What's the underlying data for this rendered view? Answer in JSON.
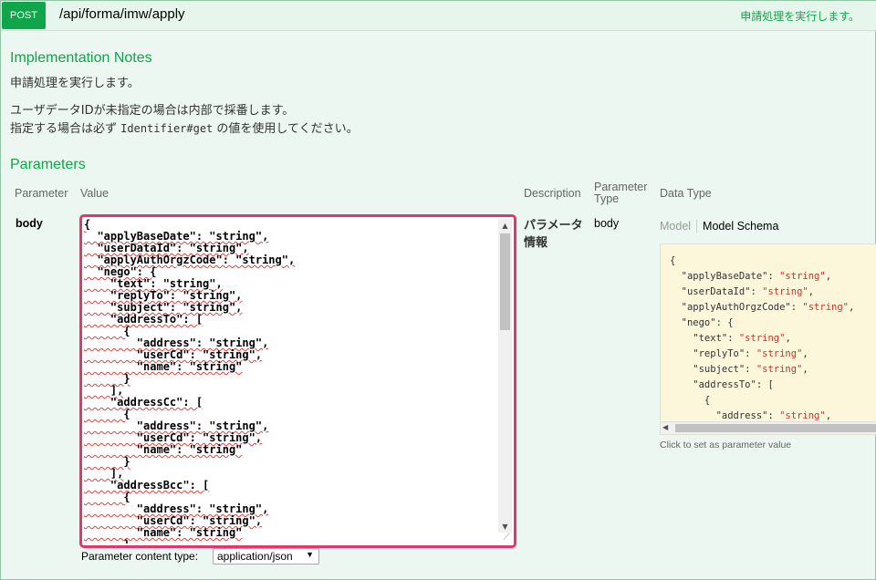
{
  "operation": {
    "method": "POST",
    "path": "/api/forma/imw/apply",
    "summary": "申請処理を実行します。"
  },
  "implementation_notes": {
    "heading": "Implementation Notes",
    "line1": "申請処理を実行します。",
    "line2": "ユーザデータIDが未指定の場合は内部で採番します。",
    "line3_pre": "指定する場合は必ず ",
    "line3_code": "Identifier#get",
    "line3_post": " の値を使用してください。"
  },
  "parameters": {
    "heading": "Parameters",
    "columns": {
      "parameter": "Parameter",
      "value": "Value",
      "description": "Description",
      "parameter_type": "Parameter Type",
      "data_type": "Data Type"
    },
    "body_row": {
      "name": "body",
      "value_text": "{\n  \"applyBaseDate\": \"string\",\n  \"userDataId\": \"string\",\n  \"applyAuthOrgzCode\": \"string\",\n  \"nego\": {\n    \"text\": \"string\",\n    \"replyTo\": \"string\",\n    \"subject\": \"string\",\n    \"addressTo\": [\n      {\n        \"address\": \"string\",\n        \"userCd\": \"string\",\n        \"name\": \"string\"\n      }\n    ],\n    \"addressCc\": [\n      {\n        \"address\": \"string\",\n        \"userCd\": \"string\",\n        \"name\": \"string\"\n      }\n    ],\n    \"addressBcc\": [\n      {\n        \"address\": \"string\",\n        \"userCd\": \"string\",\n        \"name\": \"string\"\n      }",
      "description": "パラメータ情報",
      "parameter_type": "body",
      "content_type_label": "Parameter content type:",
      "content_type_value": "application/json"
    },
    "model_tabs": {
      "model": "Model",
      "schema": "Model Schema"
    },
    "schema_lines": [
      "{",
      "  \"applyBaseDate\": \"string\",",
      "  \"userDataId\": \"string\",",
      "  \"applyAuthOrgzCode\": \"string\",",
      "  \"nego\": {",
      "    \"text\": \"string\",",
      "    \"replyTo\": \"string\",",
      "    \"subject\": \"string\",",
      "    \"addressTo\": [",
      "      {",
      "        \"address\": \"string\","
    ],
    "click_hint": "Click to set as parameter value"
  },
  "icons": {
    "scroll_up": "scroll-up-arrow-icon",
    "scroll_down": "scroll-down-arrow-icon",
    "scroll_left": "scroll-left-arrow-icon",
    "resize": "resize-grip-icon",
    "select_caret": "caret-down-icon"
  },
  "colors": {
    "method_post": "#10a54a",
    "section_heading": "#10a54a",
    "panel_bg": "#ebf7f0",
    "textarea_highlight": "#e8336b",
    "schema_bg": "#fcf6db"
  }
}
